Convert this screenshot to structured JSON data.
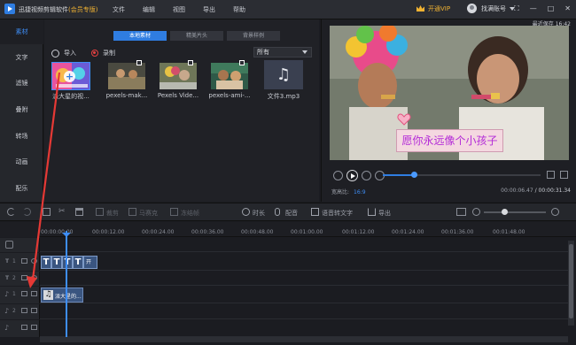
{
  "window": {
    "title": "迅捷视频剪辑软件",
    "edition": "(会员专版)",
    "menu": [
      "文件",
      "编辑",
      "视图",
      "导出",
      "帮助"
    ],
    "vip_label": "开通VIP",
    "user_name": "找满账号",
    "controls": [
      "⛶",
      "—",
      "□",
      "✕"
    ]
  },
  "sidebar": {
    "items": [
      {
        "label": "素材",
        "active": true
      },
      {
        "label": "文字",
        "active": false
      },
      {
        "label": "滤镜",
        "active": false
      },
      {
        "label": "叠附",
        "active": false
      },
      {
        "label": "转场",
        "active": false
      },
      {
        "label": "动画",
        "active": false
      },
      {
        "label": "配乐",
        "active": false
      }
    ]
  },
  "media": {
    "tabs": [
      {
        "label": "本地素材",
        "active": true
      },
      {
        "label": "精美片头",
        "active": false
      },
      {
        "label": "背景样例",
        "active": false
      }
    ],
    "import_label": "导入",
    "record_label": "录制",
    "filter_value": "所有",
    "items": [
      {
        "label": "派大星的视...",
        "icon": "add-icon"
      },
      {
        "label": "pexels-mak...",
        "icon": "video-icon"
      },
      {
        "label": "Pexels Vide...",
        "icon": "video-icon"
      },
      {
        "label": "pexels-ami-...",
        "icon": "video-icon"
      },
      {
        "label": "文件3.mp3",
        "icon": "music-note-icon"
      }
    ]
  },
  "preview": {
    "save_status": "最近保存 16:42",
    "caption": "愿你永远像个小孩子",
    "aspect_label": "宽高比:",
    "aspect_value": "16:9",
    "current_time": "00:00:06.47",
    "separator": " / ",
    "total_time": "00:00:31.34",
    "progress": 0.2
  },
  "toolbar": {
    "items": [
      {
        "label": "裁剪",
        "enabled": false
      },
      {
        "label": "马赛克",
        "enabled": false
      },
      {
        "label": "冻结帧",
        "enabled": false
      },
      {
        "label": "时长",
        "enabled": true
      },
      {
        "label": "配音",
        "enabled": true
      },
      {
        "label": "语音转文字",
        "enabled": true
      },
      {
        "label": "导出",
        "enabled": true
      }
    ]
  },
  "timeline": {
    "ticks": [
      "00:00:00.00",
      "00:00:12.00",
      "00:00:24.00",
      "00:00:36.00",
      "00:00:48.00",
      "00:01:00.00",
      "00:01:12.00",
      "00:01:24.00",
      "00:01:36.00",
      "00:01:48.00"
    ],
    "text_clip_suffix": "开",
    "text_clip_letter": "T",
    "audio_clip_label": "派大星的...",
    "track_numbers": [
      "1",
      "2",
      "1",
      "2"
    ]
  },
  "colors": {
    "accent": "#2f7de1",
    "vip": "#f0b232",
    "caption_text": "#b32ad8",
    "annotation_arrow": "#e53935"
  }
}
